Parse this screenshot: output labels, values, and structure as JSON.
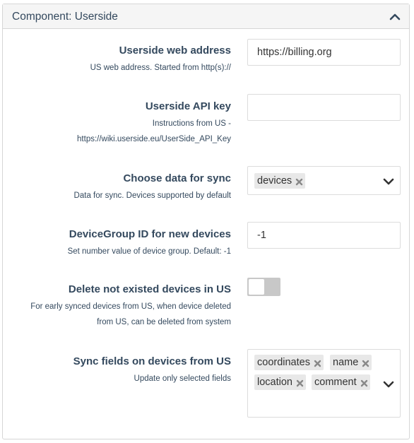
{
  "panel": {
    "title": "Component: Userside"
  },
  "fields": {
    "web_address": {
      "label": "Userside web address",
      "help": "US web address. Started from http(s)://",
      "value": "https://billing.org"
    },
    "api_key": {
      "label": "Userside API key",
      "help_line1": "Instructions from US -",
      "help_line2": "https://wiki.userside.eu/UserSide_API_Key",
      "value": ""
    },
    "sync_data": {
      "label": "Choose data for sync",
      "help": "Data for sync. Devices supported by default",
      "selected": [
        "devices"
      ]
    },
    "device_group": {
      "label": "DeviceGroup ID for new devices",
      "help": "Set number value of device group. Default: -1",
      "value": "-1"
    },
    "delete_devices": {
      "label": "Delete not existed devices in US",
      "help_line1": "For early synced devices from US, when device deleted",
      "help_line2": "from US, can be deleted from system",
      "enabled": false
    },
    "sync_fields": {
      "label": "Sync fields on devices from US",
      "help": "Update only selected fields",
      "selected": [
        "coordinates",
        "name",
        "location",
        "comment"
      ]
    }
  },
  "icons": {
    "collapse": "chevron-up-icon",
    "dropdown": "chevron-down-icon",
    "chip_remove": "close-icon"
  },
  "colors": {
    "text": "#34495e",
    "header_bg": "#f5f5f5",
    "border": "#d6d6d6",
    "chip_bg": "#e8e8e8",
    "toggle_off": "#c8c8c8"
  }
}
